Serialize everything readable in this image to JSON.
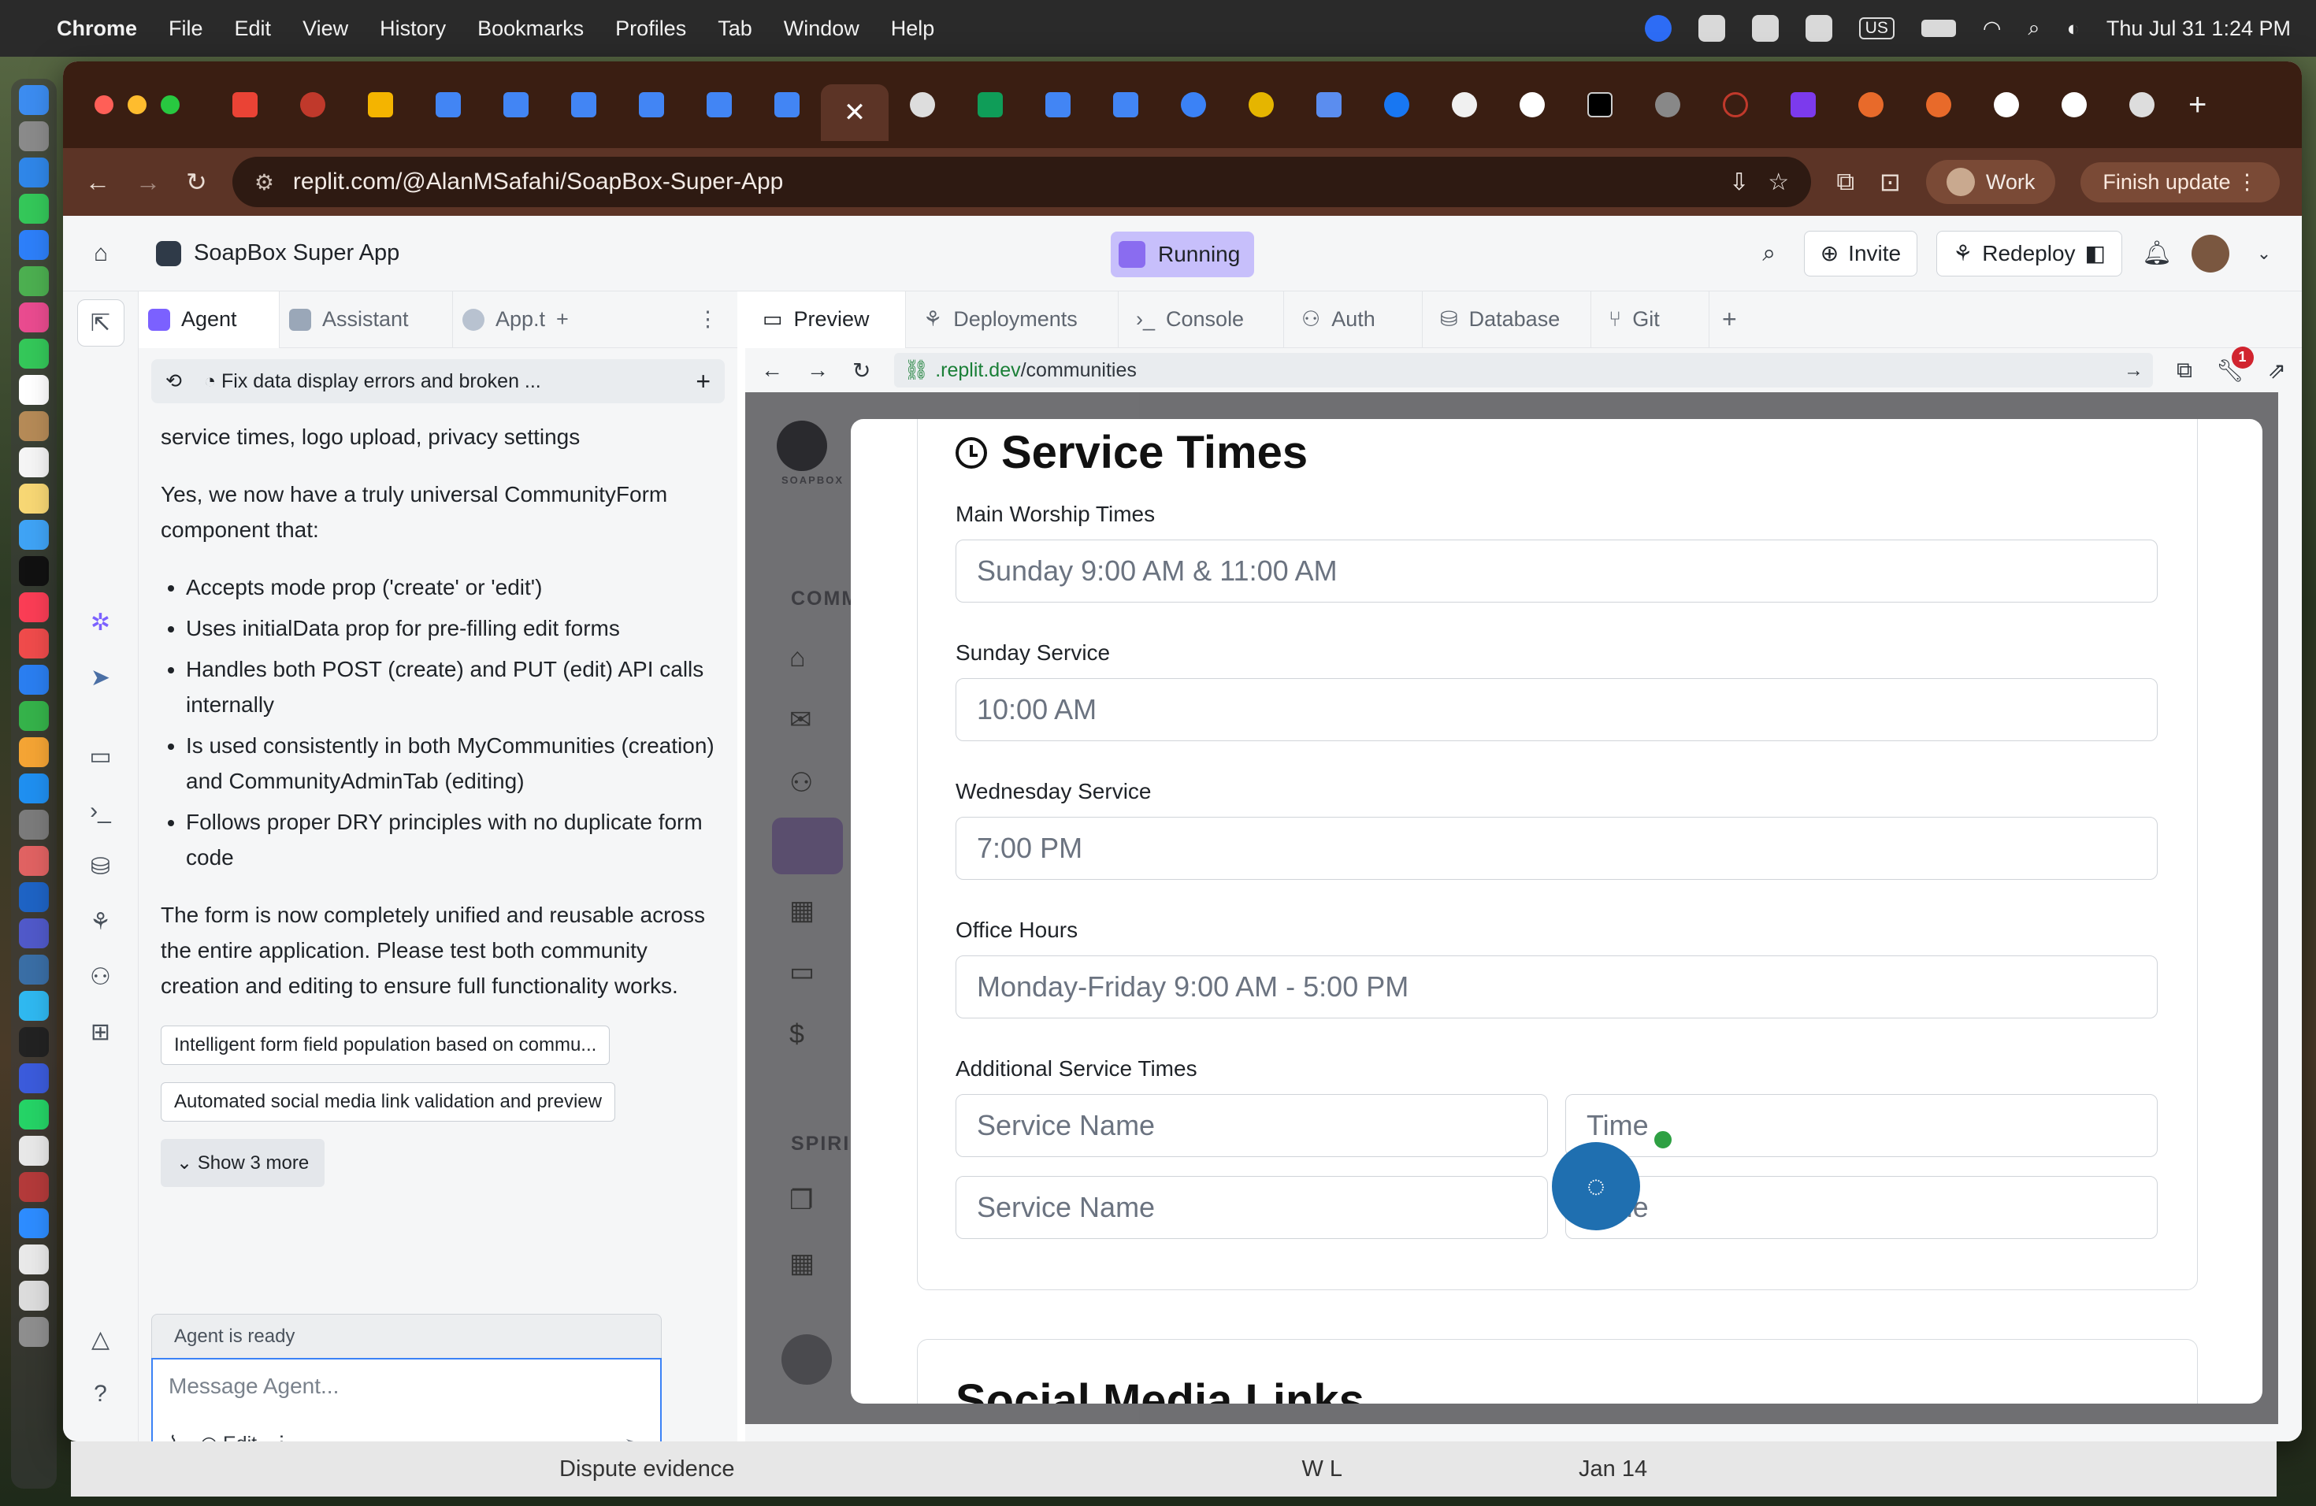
{
  "menubar": {
    "app": "Chrome",
    "items": [
      "File",
      "Edit",
      "View",
      "History",
      "Bookmarks",
      "Profiles",
      "Tab",
      "Window",
      "Help"
    ],
    "zoom_icon": "zm",
    "keyboard": "US",
    "datetime": "Thu Jul 31  1:24 PM"
  },
  "browser": {
    "url": "replit.com/@AlanMSafahi/SoapBox-Super-App",
    "profile": "Work",
    "update": "Finish update",
    "close_tab_glyph": "✕"
  },
  "replit": {
    "app_title": "SoapBox Super App",
    "status": "Running",
    "invite": "Invite",
    "redeploy": "Redeploy"
  },
  "agent": {
    "tabs": [
      "Agent",
      "Assistant",
      "App.t"
    ],
    "thread_title": "Fix data display errors and broken ...",
    "cut_line": "service times, logo upload, privacy settings",
    "para1": "Yes, we now have a truly universal CommunityForm component that:",
    "bullets": [
      "Accepts mode prop ('create' or 'edit')",
      "Uses initialData prop for pre-filling edit forms",
      "Handles both POST (create) and PUT (edit) API calls internally",
      "Is used consistently in both MyCommunities (creation) and CommunityAdminTab (editing)",
      "Follows proper DRY principles with no duplicate form code"
    ],
    "para2": "The form is now completely unified and reusable across the entire application. Please test both community creation and editing to ensure full functionality works.",
    "suggestions": [
      "Intelligent form field population based on commu...",
      "Automated social media link validation and preview"
    ],
    "show_more": "Show 3 more",
    "status": "Agent is ready",
    "placeholder": "Message Agent...",
    "edit_label": "Edit"
  },
  "workspace": {
    "tabs": [
      "Preview",
      "Deployments",
      "Console",
      "Auth",
      "Database",
      "Git"
    ],
    "url_domain": ".replit.dev",
    "url_path": "/communities",
    "notif_count": "1"
  },
  "background_app": {
    "logo_caption": "SOAPBOX",
    "section1": "COMM",
    "section2": "SPIRI"
  },
  "form": {
    "heading": "Service Times",
    "fields": [
      {
        "label": "Main Worship Times",
        "placeholder": "Sunday 9:00 AM & 11:00 AM"
      },
      {
        "label": "Sunday Service",
        "placeholder": "10:00 AM"
      },
      {
        "label": "Wednesday Service",
        "placeholder": "7:00 PM"
      },
      {
        "label": "Office Hours",
        "placeholder": "Monday-Friday 9:00 AM - 5:00 PM"
      }
    ],
    "additional_label": "Additional Service Times",
    "service_name_placeholder": "Service Name",
    "time_placeholder": "Time",
    "next_heading_cut": "Social Media Links"
  },
  "peek_row": {
    "title": "Dispute evidence",
    "who": "W L",
    "date": "Jan 14"
  }
}
